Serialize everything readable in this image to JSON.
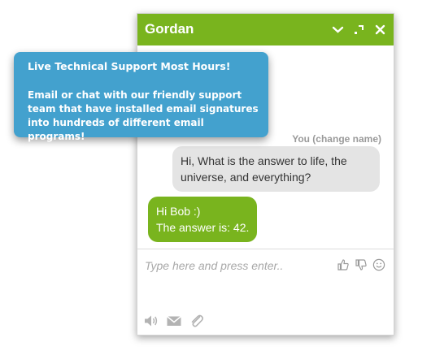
{
  "chat": {
    "agent_name": "Gordan",
    "header_icons": [
      "chevron-down-icon",
      "minimize-icon",
      "close-icon"
    ],
    "messages": [
      {
        "sender_label": "You (change name)",
        "text": "Hi, What is the answer to life, the universe, and everything?"
      },
      {
        "lines": [
          "Hi Bob :)",
          "The answer is: 42."
        ]
      }
    ],
    "input_placeholder": "Type here and press enter..",
    "composer_icons": [
      "thumbs-up-icon",
      "thumbs-down-icon",
      "smiley-icon"
    ],
    "footer_icons": [
      "sound-icon",
      "email-icon",
      "attachment-icon"
    ]
  },
  "callout": {
    "title": "Live Technical Support Most Hours!",
    "body": "Email or chat with our friendly support team that have installed email signatures into hundreds of different email programs!"
  },
  "colors": {
    "brand_green": "#79b41e",
    "callout_blue": "#43a1ce",
    "user_bubble": "#e4e4e4",
    "placeholder_gray": "#a8a8a8"
  }
}
